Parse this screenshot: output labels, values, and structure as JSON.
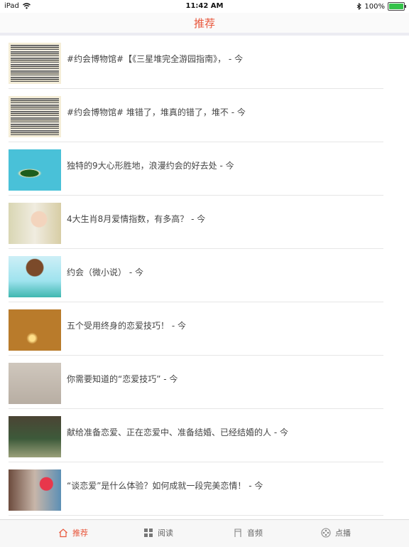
{
  "status_bar": {
    "carrier": "iPad",
    "time": "11:42 AM",
    "battery": "100%",
    "battery_level": 1.0
  },
  "nav": {
    "title": "推荐"
  },
  "articles": [
    {
      "title": "#约会博物馆#【《三星堆完全游园指南》， - 今",
      "thumb": "stripes-image"
    },
    {
      "title": "#约会博物馆# 堆错了，堆真的错了，堆不 - 今",
      "thumb": "stripes-image"
    },
    {
      "title": "独特的9大心形胜地，浪漫约会的好去处 - 今",
      "thumb": "island-image"
    },
    {
      "title": "4大生肖8月爱情指数，有多高？ - 今",
      "thumb": "girl-image"
    },
    {
      "title": "约会（微小说） - 今",
      "thumb": "cartoon-image"
    },
    {
      "title": "五个受用终身的恋爱技巧！ - 今",
      "thumb": "dark-image"
    },
    {
      "title": "你需要知道的“恋爱技巧” - 今",
      "thumb": "handwriting-image"
    },
    {
      "title": "献给准备恋爱、正在恋爱中、准备结婚、已经结婚的人 - 今",
      "thumb": "couple-image"
    },
    {
      "title": "“谈恋爱”是什么体验？如何成就一段完美恋情！ - 今",
      "thumb": "heart-image"
    }
  ],
  "tabs": [
    {
      "label": "推荐",
      "icon": "home-icon"
    },
    {
      "label": "阅读",
      "icon": "grid-icon"
    },
    {
      "label": "音频",
      "icon": "music-icon"
    },
    {
      "label": "点播",
      "icon": "film-reel-icon"
    }
  ],
  "colors": {
    "accent": "#e8553a"
  }
}
